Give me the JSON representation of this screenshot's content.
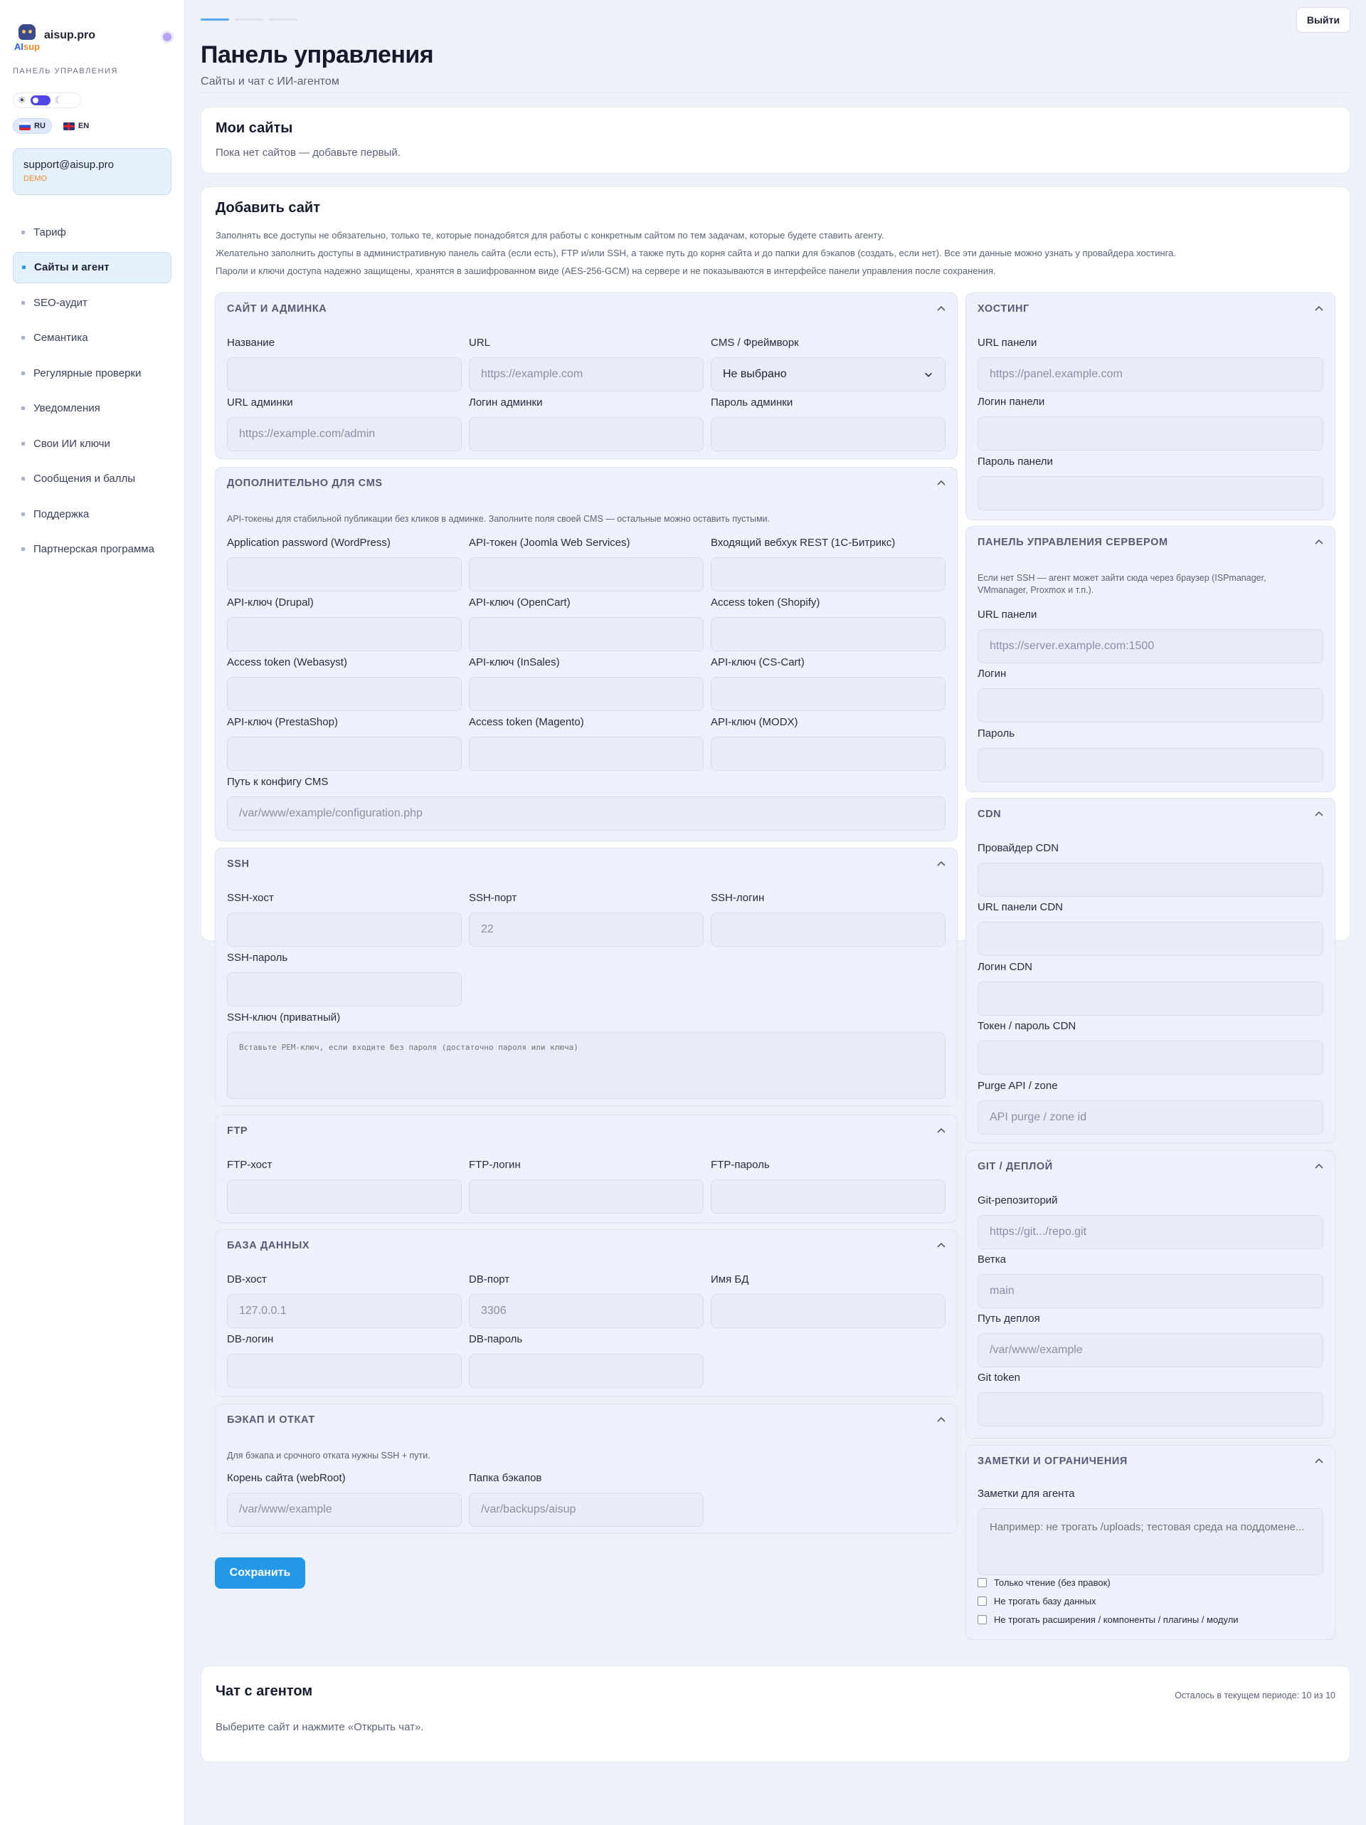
{
  "brand": {
    "name": "aisup.pro",
    "badge_ai": "AI",
    "badge_sup": "sup",
    "panel_label": "ПАНЕЛЬ УПРАВЛЕНИЯ"
  },
  "theme": {
    "sun_icon": "☀",
    "moon_icon": "☾"
  },
  "langs": [
    {
      "code": "RU",
      "active": true
    },
    {
      "code": "EN",
      "active": false
    }
  ],
  "user": {
    "email": "support@aisup.pro",
    "role": "DEMO"
  },
  "nav": [
    {
      "label": "Тариф",
      "active": false
    },
    {
      "label": "Сайты и агент",
      "active": true
    },
    {
      "label": "SEO-аудит",
      "active": false
    },
    {
      "label": "Семантика",
      "active": false
    },
    {
      "label": "Регулярные проверки",
      "active": false
    },
    {
      "label": "Уведомления",
      "active": false
    },
    {
      "label": "Свои ИИ ключи",
      "active": false
    },
    {
      "label": "Сообщения и баллы",
      "active": false
    },
    {
      "label": "Поддержка",
      "active": false
    },
    {
      "label": "Партнерская программа",
      "active": false
    }
  ],
  "header": {
    "logout": "Выйти",
    "title": "Панель управления",
    "subtitle": "Сайты и чат с ИИ-агентом"
  },
  "my_sites": {
    "title": "Мои сайты",
    "empty": "Пока нет сайтов — добавьте первый."
  },
  "add_site": {
    "title": "Добавить сайт",
    "intro": [
      "Заполнять все доступы не обязательно, только те, которые понадобятся для работы с конкретным сайтом по тем задачам, которые будете ставить агенту.",
      "Желательно заполнить доступы в административную панель сайта (если есть), FTP и/или SSH, а также путь до корня сайта и до папки для бэкапов (создать, если нет). Все эти данные можно узнать у провайдера хостинга.",
      "Пароли и ключи доступа надежно защищены, хранятся в зашифрованном виде (AES-256-GCM) на сервере и не показываются в интерфейсе панели управления после сохранения."
    ],
    "save": "Сохранить"
  },
  "sections": {
    "site": {
      "title": "Сайт и админка",
      "fields": {
        "name": "Название",
        "url": "URL",
        "url_ph": "https://example.com",
        "cms": "CMS / Фреймворк",
        "cms_value": "Не выбрано",
        "admin_url": "URL админки",
        "admin_url_ph": "https://example.com/admin",
        "admin_login": "Логин админки",
        "admin_pass": "Пароль админки"
      }
    },
    "cms": {
      "title": "Дополнительно для CMS",
      "note": "API-токены для стабильной публикации без кликов в админке. Заполните поля своей CMS — остальные можно оставить пустыми.",
      "fields": [
        "Application password (WordPress)",
        "API-токен (Joomla Web Services)",
        "Входящий вебхук REST (1С-Битрикс)",
        "API-ключ (Drupal)",
        "API-ключ (OpenCart)",
        "Access token (Shopify)",
        "Access token (Webasyst)",
        "API-ключ (InSales)",
        "API-ключ (CS-Cart)",
        "API-ключ (PrestaShop)",
        "Access token (Magento)",
        "API-ключ (MODX)"
      ],
      "config_label": "Путь к конфигу CMS",
      "config_ph": "/var/www/example/configuration.php"
    },
    "ssh": {
      "title": "SSH",
      "host": "SSH-хост",
      "port": "SSH-порт",
      "port_ph": "22",
      "login": "SSH-логин",
      "pass": "SSH-пароль",
      "key": "SSH-ключ (приватный)",
      "key_ph": "Вставьте PEM-ключ, если входите без пароля (достаточно пароля или ключа)"
    },
    "ftp": {
      "title": "FTP",
      "host": "FTP-хост",
      "login": "FTP-логин",
      "pass": "FTP-пароль"
    },
    "db": {
      "title": "База данных",
      "host": "DB-хост",
      "host_ph": "127.0.0.1",
      "port": "DB-порт",
      "port_ph": "3306",
      "name": "Имя БД",
      "login": "DB-логин",
      "pass": "DB-пароль"
    },
    "backup": {
      "title": "Бэкап и откат",
      "note": "Для бэкапа и срочного отката нужны SSH + пути.",
      "root": "Корень сайта (webRoot)",
      "root_ph": "/var/www/example",
      "folder": "Папка бэкапов",
      "folder_ph": "/var/backups/aisup"
    },
    "hosting": {
      "title": "Хостинг",
      "url": "URL панели",
      "url_ph": "https://panel.example.com",
      "login": "Логин панели",
      "pass": "Пароль панели"
    },
    "server": {
      "title": "Панель управления сервером",
      "note": "Если нет SSH — агент может зайти сюда через браузер (ISPmanager, VMmanager, Proxmox и т.п.).",
      "url": "URL панели",
      "url_ph": "https://server.example.com:1500",
      "login": "Логин",
      "pass": "Пароль"
    },
    "cdn": {
      "title": "CDN",
      "provider": "Провайдер CDN",
      "url": "URL панели CDN",
      "login": "Логин CDN",
      "token": "Токен / пароль CDN",
      "purge": "Purge API / zone",
      "purge_ph": "API purge / zone id"
    },
    "git": {
      "title": "Git / деплой",
      "repo": "Git-репозиторий",
      "repo_ph": "https://git.../repo.git",
      "branch": "Ветка",
      "branch_ph": "main",
      "path": "Путь деплоя",
      "path_ph": "/var/www/example",
      "token": "Git token"
    },
    "notes": {
      "title": "Заметки и ограничения",
      "label": "Заметки для агента",
      "ph": "Например: не трогать /uploads; тестовая среда на поддомене...",
      "checks": [
        "Только чтение (без правок)",
        "Не трогать базу данных",
        "Не трогать расширения / компоненты / плагины / модули"
      ]
    }
  },
  "chat": {
    "title": "Чат с агентом",
    "quota": "Осталось в текущем периоде: 10 из 10",
    "hint": "Выберите сайт и нажмите «Открыть чат»."
  }
}
